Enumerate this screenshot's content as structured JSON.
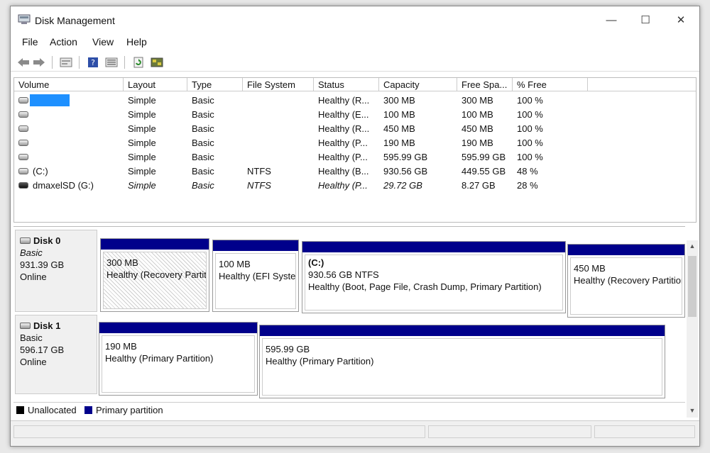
{
  "window": {
    "title": "Disk Management",
    "minimize": "—",
    "maximize": "☐",
    "close": "✕"
  },
  "menu": [
    "File",
    "Action",
    "View",
    "Help"
  ],
  "toolbar": [
    "back-icon",
    "forward-icon",
    "properties-icon",
    "help-icon",
    "list-view-icon",
    "refresh-icon",
    "settings-icon"
  ],
  "columns": [
    "Volume",
    "Layout",
    "Type",
    "File System",
    "Status",
    "Capacity",
    "Free Spa...",
    "% Free"
  ],
  "volumes": [
    {
      "name": "",
      "layout": "Simple",
      "type": "Basic",
      "fs": "",
      "status": "Healthy (R...",
      "capacity": "300 MB",
      "free": "300 MB",
      "pct": "100 %"
    },
    {
      "name": "",
      "layout": "Simple",
      "type": "Basic",
      "fs": "",
      "status": "Healthy (E...",
      "capacity": "100 MB",
      "free": "100 MB",
      "pct": "100 %"
    },
    {
      "name": "",
      "layout": "Simple",
      "type": "Basic",
      "fs": "",
      "status": "Healthy (R...",
      "capacity": "450 MB",
      "free": "450 MB",
      "pct": "100 %"
    },
    {
      "name": "",
      "layout": "Simple",
      "type": "Basic",
      "fs": "",
      "status": "Healthy (P...",
      "capacity": "190 MB",
      "free": "190 MB",
      "pct": "100 %"
    },
    {
      "name": "",
      "layout": "Simple",
      "type": "Basic",
      "fs": "",
      "status": "Healthy (P...",
      "capacity": "595.99 GB",
      "free": "595.99 GB",
      "pct": "100 %"
    },
    {
      "name": "(C:)",
      "layout": "Simple",
      "type": "Basic",
      "fs": "NTFS",
      "status": "Healthy (B...",
      "capacity": "930.56 GB",
      "free": "449.55 GB",
      "pct": "48 %"
    },
    {
      "name": "dmaxelSD (G:)",
      "layout": "Simple",
      "type": "Basic",
      "fs": "NTFS",
      "status": "Healthy (P...",
      "capacity": "29.72 GB",
      "free": "8.27 GB",
      "pct": "28 %"
    }
  ],
  "disks": [
    {
      "name": "Disk 0",
      "type": "Basic",
      "size": "931.39 GB",
      "state": "Online",
      "partitions": [
        {
          "label": "",
          "size": "300 MB",
          "status": "Healthy (Recovery Partition)"
        },
        {
          "label": "",
          "size": "100 MB",
          "status": "Healthy (EFI System Partition)"
        },
        {
          "label": "(C:)",
          "size": "930.56 GB NTFS",
          "status": "Healthy (Boot, Page File, Crash Dump, Primary Partition)"
        },
        {
          "label": "",
          "size": "450 MB",
          "status": "Healthy (Recovery Partition)"
        }
      ]
    },
    {
      "name": "Disk 1",
      "type": "Basic",
      "size": "596.17 GB",
      "state": "Online",
      "partitions": [
        {
          "label": "",
          "size": "190 MB",
          "status": "Healthy (Primary Partition)"
        },
        {
          "label": "",
          "size": "595.99 GB",
          "status": "Healthy (Primary Partition)"
        }
      ]
    }
  ],
  "legend": [
    {
      "label": "Unallocated",
      "color": "#000000"
    },
    {
      "label": "Primary partition",
      "color": "#00008b"
    }
  ],
  "colors": {
    "partition_bar": "#00008b",
    "selection": "#1e90ff"
  }
}
